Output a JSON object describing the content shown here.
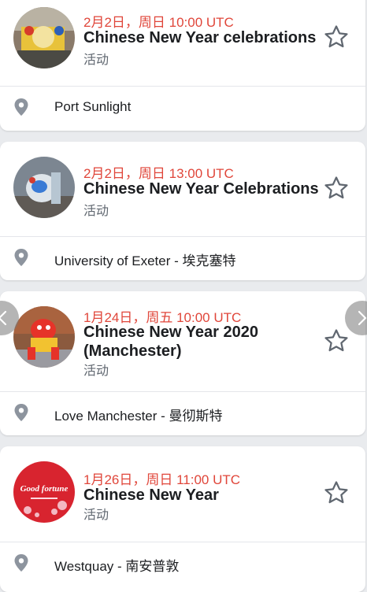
{
  "events": [
    {
      "date": "2月2日，周日 10:00 UTC",
      "title": "Chinese New Year celebrations",
      "type": "活动",
      "location": "Port Sunlight"
    },
    {
      "date": "2月2日，周日 13:00 UTC",
      "title": "Chinese New Year Celebrations",
      "type": "活动",
      "location": "University of Exeter - 埃克塞特"
    },
    {
      "date": "1月24日，周五 10:00 UTC",
      "title_line1": "Chinese New Year 2020",
      "title_line2": "(Manchester)",
      "type": "活动",
      "location": "Love Manchester - 曼彻斯特"
    },
    {
      "date": "1月26日，周日 11:00 UTC",
      "title": "Chinese New Year",
      "type": "活动",
      "location": "Westquay - 南安普敦",
      "thumb_text": "Good fortune"
    }
  ],
  "colors": {
    "date": "#e0463a",
    "background": "#e9ebee"
  },
  "icons": {
    "star": "star-outline-icon",
    "location": "map-pin-icon",
    "prev": "chevron-left-icon",
    "next": "chevron-right-icon"
  }
}
